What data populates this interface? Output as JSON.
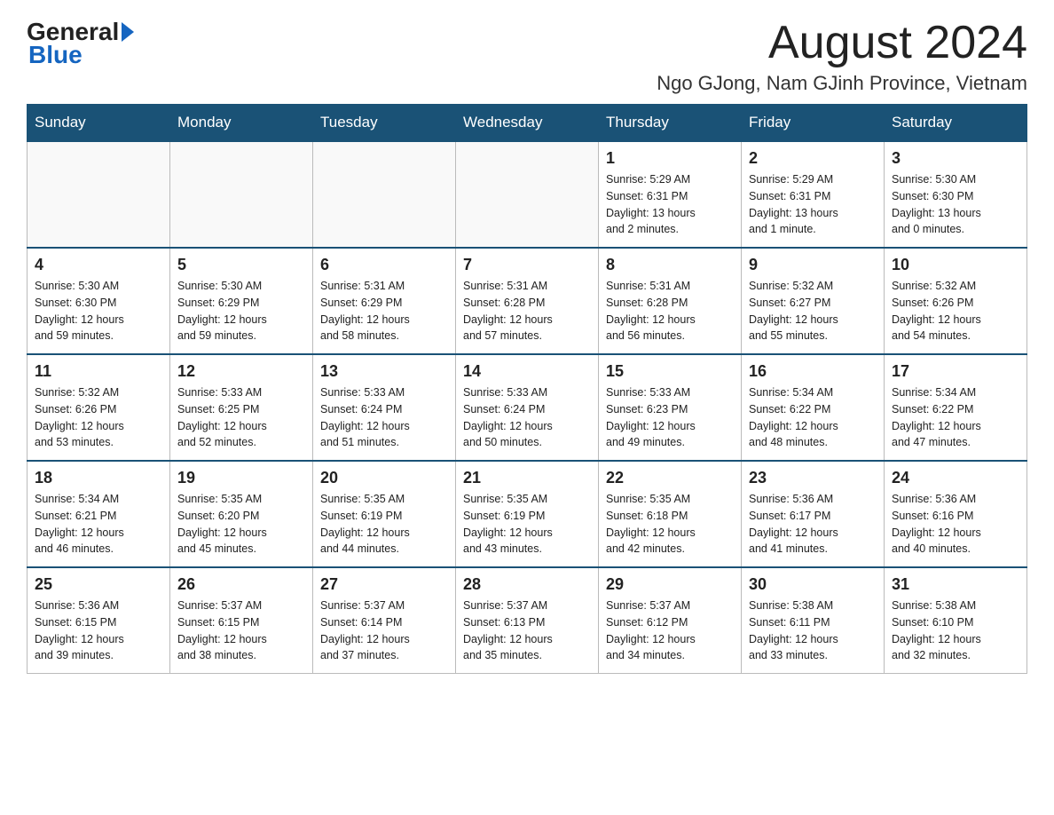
{
  "header": {
    "title": "August 2024",
    "subtitle": "Ngo GJong, Nam GJinh Province, Vietnam"
  },
  "logo": {
    "general": "General",
    "blue": "Blue"
  },
  "days_of_week": [
    "Sunday",
    "Monday",
    "Tuesday",
    "Wednesday",
    "Thursday",
    "Friday",
    "Saturday"
  ],
  "weeks": [
    [
      {
        "day": "",
        "info": ""
      },
      {
        "day": "",
        "info": ""
      },
      {
        "day": "",
        "info": ""
      },
      {
        "day": "",
        "info": ""
      },
      {
        "day": "1",
        "info": "Sunrise: 5:29 AM\nSunset: 6:31 PM\nDaylight: 13 hours\nand 2 minutes."
      },
      {
        "day": "2",
        "info": "Sunrise: 5:29 AM\nSunset: 6:31 PM\nDaylight: 13 hours\nand 1 minute."
      },
      {
        "day": "3",
        "info": "Sunrise: 5:30 AM\nSunset: 6:30 PM\nDaylight: 13 hours\nand 0 minutes."
      }
    ],
    [
      {
        "day": "4",
        "info": "Sunrise: 5:30 AM\nSunset: 6:30 PM\nDaylight: 12 hours\nand 59 minutes."
      },
      {
        "day": "5",
        "info": "Sunrise: 5:30 AM\nSunset: 6:29 PM\nDaylight: 12 hours\nand 59 minutes."
      },
      {
        "day": "6",
        "info": "Sunrise: 5:31 AM\nSunset: 6:29 PM\nDaylight: 12 hours\nand 58 minutes."
      },
      {
        "day": "7",
        "info": "Sunrise: 5:31 AM\nSunset: 6:28 PM\nDaylight: 12 hours\nand 57 minutes."
      },
      {
        "day": "8",
        "info": "Sunrise: 5:31 AM\nSunset: 6:28 PM\nDaylight: 12 hours\nand 56 minutes."
      },
      {
        "day": "9",
        "info": "Sunrise: 5:32 AM\nSunset: 6:27 PM\nDaylight: 12 hours\nand 55 minutes."
      },
      {
        "day": "10",
        "info": "Sunrise: 5:32 AM\nSunset: 6:26 PM\nDaylight: 12 hours\nand 54 minutes."
      }
    ],
    [
      {
        "day": "11",
        "info": "Sunrise: 5:32 AM\nSunset: 6:26 PM\nDaylight: 12 hours\nand 53 minutes."
      },
      {
        "day": "12",
        "info": "Sunrise: 5:33 AM\nSunset: 6:25 PM\nDaylight: 12 hours\nand 52 minutes."
      },
      {
        "day": "13",
        "info": "Sunrise: 5:33 AM\nSunset: 6:24 PM\nDaylight: 12 hours\nand 51 minutes."
      },
      {
        "day": "14",
        "info": "Sunrise: 5:33 AM\nSunset: 6:24 PM\nDaylight: 12 hours\nand 50 minutes."
      },
      {
        "day": "15",
        "info": "Sunrise: 5:33 AM\nSunset: 6:23 PM\nDaylight: 12 hours\nand 49 minutes."
      },
      {
        "day": "16",
        "info": "Sunrise: 5:34 AM\nSunset: 6:22 PM\nDaylight: 12 hours\nand 48 minutes."
      },
      {
        "day": "17",
        "info": "Sunrise: 5:34 AM\nSunset: 6:22 PM\nDaylight: 12 hours\nand 47 minutes."
      }
    ],
    [
      {
        "day": "18",
        "info": "Sunrise: 5:34 AM\nSunset: 6:21 PM\nDaylight: 12 hours\nand 46 minutes."
      },
      {
        "day": "19",
        "info": "Sunrise: 5:35 AM\nSunset: 6:20 PM\nDaylight: 12 hours\nand 45 minutes."
      },
      {
        "day": "20",
        "info": "Sunrise: 5:35 AM\nSunset: 6:19 PM\nDaylight: 12 hours\nand 44 minutes."
      },
      {
        "day": "21",
        "info": "Sunrise: 5:35 AM\nSunset: 6:19 PM\nDaylight: 12 hours\nand 43 minutes."
      },
      {
        "day": "22",
        "info": "Sunrise: 5:35 AM\nSunset: 6:18 PM\nDaylight: 12 hours\nand 42 minutes."
      },
      {
        "day": "23",
        "info": "Sunrise: 5:36 AM\nSunset: 6:17 PM\nDaylight: 12 hours\nand 41 minutes."
      },
      {
        "day": "24",
        "info": "Sunrise: 5:36 AM\nSunset: 6:16 PM\nDaylight: 12 hours\nand 40 minutes."
      }
    ],
    [
      {
        "day": "25",
        "info": "Sunrise: 5:36 AM\nSunset: 6:15 PM\nDaylight: 12 hours\nand 39 minutes."
      },
      {
        "day": "26",
        "info": "Sunrise: 5:37 AM\nSunset: 6:15 PM\nDaylight: 12 hours\nand 38 minutes."
      },
      {
        "day": "27",
        "info": "Sunrise: 5:37 AM\nSunset: 6:14 PM\nDaylight: 12 hours\nand 37 minutes."
      },
      {
        "day": "28",
        "info": "Sunrise: 5:37 AM\nSunset: 6:13 PM\nDaylight: 12 hours\nand 35 minutes."
      },
      {
        "day": "29",
        "info": "Sunrise: 5:37 AM\nSunset: 6:12 PM\nDaylight: 12 hours\nand 34 minutes."
      },
      {
        "day": "30",
        "info": "Sunrise: 5:38 AM\nSunset: 6:11 PM\nDaylight: 12 hours\nand 33 minutes."
      },
      {
        "day": "31",
        "info": "Sunrise: 5:38 AM\nSunset: 6:10 PM\nDaylight: 12 hours\nand 32 minutes."
      }
    ]
  ]
}
